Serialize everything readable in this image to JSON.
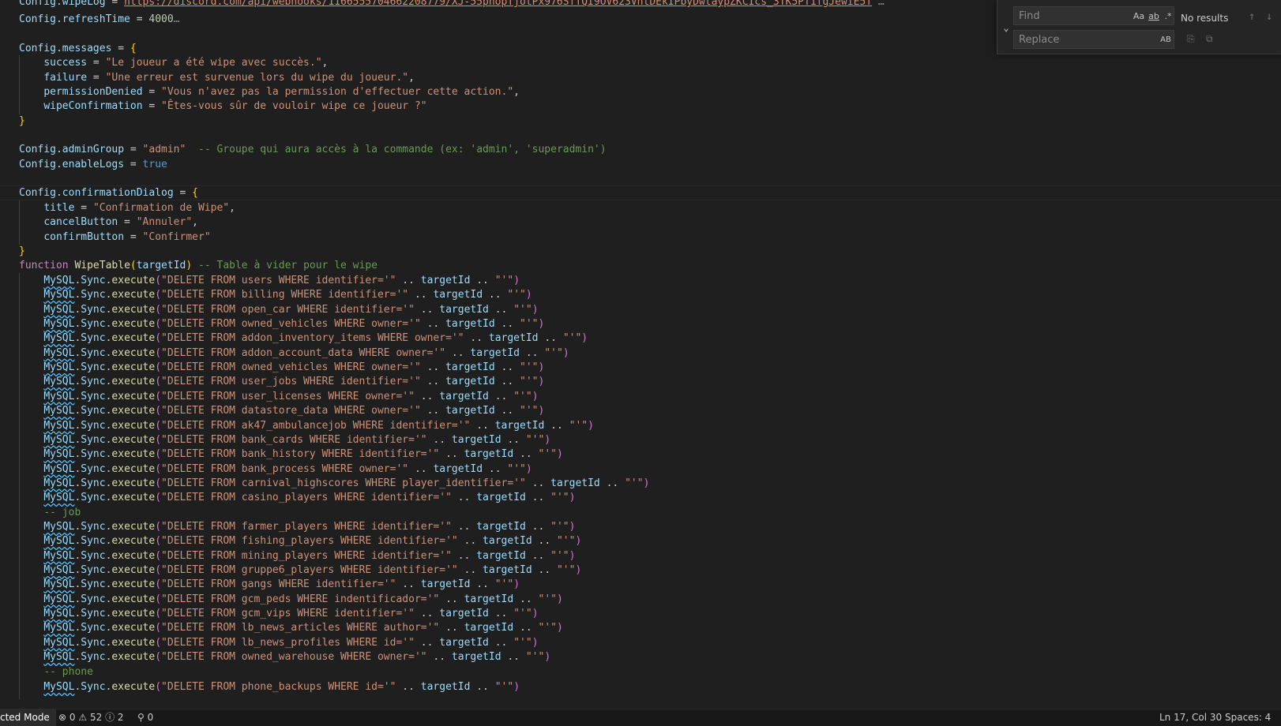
{
  "find_widget": {
    "find_placeholder": "Find",
    "replace_placeholder": "Replace",
    "match_case": "Aa",
    "whole_word": "ab",
    "regex": ".*",
    "preserve_case": "AB",
    "results": "No results"
  },
  "status_bar": {
    "mode": "cted Mode",
    "errors": "0",
    "warnings": "52",
    "info": "2",
    "ports": "0",
    "cursor_position": "Ln 17, Col 30",
    "indentation": "Spaces: 4"
  },
  "code": {
    "top_partial_var": "Config.wipeLog",
    "top_partial_url": "https://discord.com/api/webhooks/1166555704662208779/XJ-55phopTjotPx976SfTQI9OV623VhtDEkIPbyDwtaypZKCIcs_3TK5PT1fgJewiE5T",
    "refresh_var": "Config.refreshTime",
    "refresh_value": "4000",
    "messages_var": "Config.messages",
    "success_key": "success",
    "success_val": "\"Le joueur a été wipe avec succès.\"",
    "failure_key": "failure",
    "failure_val": "\"Une erreur est survenue lors du wipe du joueur.\"",
    "perm_key": "permissionDenied",
    "perm_val": "\"Vous n'avez pas la permission d'effectuer cette action.\"",
    "wipeconf_key": "wipeConfirmation",
    "wipeconf_val": "\"Êtes-vous sûr de vouloir wipe ce joueur ?\"",
    "admin_var": "Config.adminGroup",
    "admin_val": "\"admin\"",
    "admin_comment": "-- Groupe qui aura accès à la commande (ex: 'admin', 'superadmin')",
    "logs_var": "Config.enableLogs",
    "logs_val": "true",
    "dialog_var": "Config.confirmationDialog",
    "title_key": "title",
    "title_val": "\"Confirmation de Wipe\"",
    "cancel_key": "cancelButton",
    "cancel_val": "\"Annuler\"",
    "confirm_key": "confirmButton",
    "confirm_val": "\"Confirmer\"",
    "function_kw": "function",
    "function_name": "WipeTable",
    "function_param": "targetId",
    "function_comment": "-- Table à vider pour le wipe",
    "sql_obj": "MySQL",
    "sql_sync": "Sync",
    "sql_exec": "execute",
    "sql_var": "targetId",
    "comment_job": "-- job",
    "comment_phone": "-- phone"
  },
  "sql_lines": [
    {
      "table": "users",
      "col": "identifier"
    },
    {
      "table": "billing",
      "col": "identifier"
    },
    {
      "table": "open_car",
      "col": "identifier"
    },
    {
      "table": "owned_vehicles",
      "col": "owner"
    },
    {
      "table": "addon_inventory_items",
      "col": "owner"
    },
    {
      "table": "addon_account_data",
      "col": "owner"
    },
    {
      "table": "owned_vehicles",
      "col": "owner"
    },
    {
      "table": "user_jobs",
      "col": "identifier"
    },
    {
      "table": "user_licenses",
      "col": "owner"
    },
    {
      "table": "datastore_data",
      "col": "owner"
    },
    {
      "table": "ak47_ambulancejob",
      "col": "identifier"
    },
    {
      "table": "bank_cards",
      "col": "identifier"
    },
    {
      "table": "bank_history",
      "col": "identifier"
    },
    {
      "table": "bank_process",
      "col": "owner"
    },
    {
      "table": "carnival_highscores",
      "col": "player_identifier"
    },
    {
      "table": "casino_players",
      "col": "identifier"
    }
  ],
  "sql_lines_job": [
    {
      "table": "farmer_players",
      "col": "identifier"
    },
    {
      "table": "fishing_players",
      "col": "identifier"
    },
    {
      "table": "mining_players",
      "col": "identifier"
    },
    {
      "table": "gruppe6_players",
      "col": "identifier"
    },
    {
      "table": "gangs",
      "col": "identifier"
    },
    {
      "table": "gcm_peds",
      "col": "indentificador"
    },
    {
      "table": "gcm_vips",
      "col": "identifier"
    },
    {
      "table": "lb_news_articles",
      "col": "author"
    },
    {
      "table": "lb_news_profiles",
      "col": "id"
    },
    {
      "table": "owned_warehouse",
      "col": "owner"
    }
  ],
  "sql_partial_last": {
    "table": "phone_backups",
    "col": "id"
  },
  "colors": {
    "background": "#1f1f1f",
    "variable": "#9cdcfe",
    "string": "#ce9178",
    "comment": "#6a9955",
    "keyword": "#569cd6",
    "function": "#dcdcaa",
    "number": "#b5cea8"
  }
}
